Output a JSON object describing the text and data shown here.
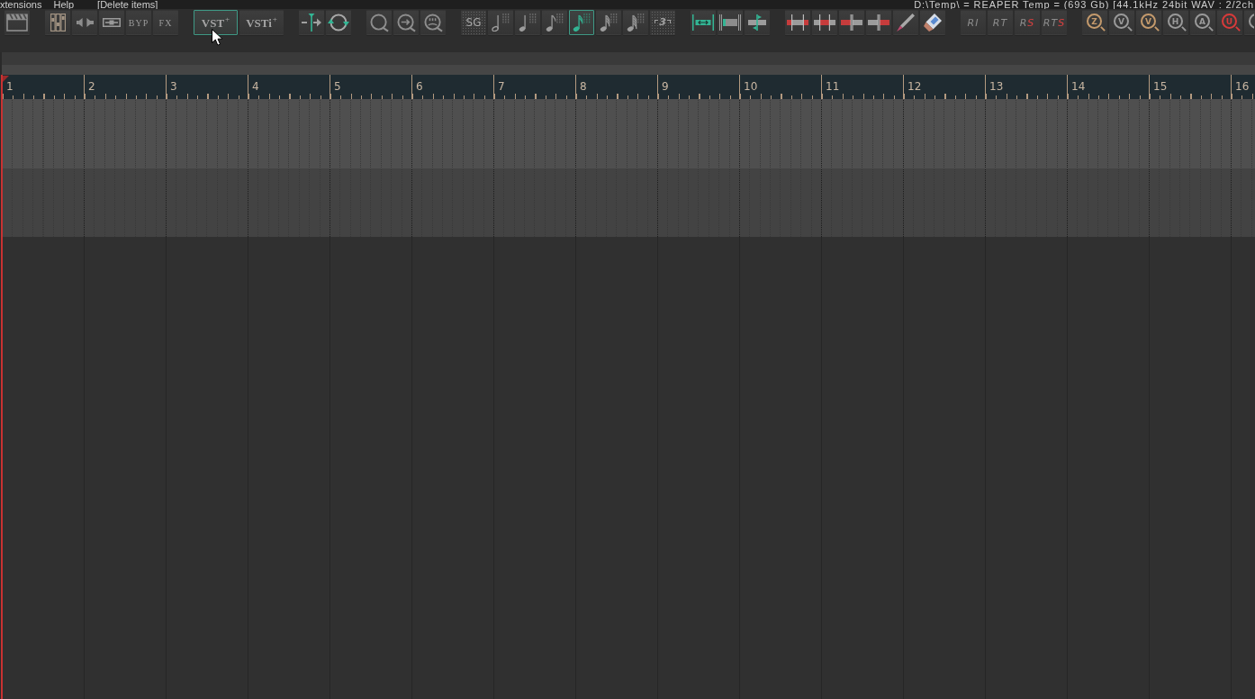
{
  "menu_bar": {
    "items": [
      "xtensions",
      "Help"
    ],
    "last_action": "[Delete items]",
    "project_info": "D:\\Temp\\ = REAPER Temp = (693 Gb) [44.1kHz 24bit WAV : 2/2ch"
  },
  "toolbar": {
    "groups": [
      {
        "buttons": [
          {
            "kind": "clapperboard",
            "selected": false
          }
        ]
      },
      {
        "buttons": [
          {
            "kind": "faders",
            "selected": false
          },
          {
            "kind": "speakers",
            "selected": false
          },
          {
            "kind": "fader-box",
            "selected": false
          },
          {
            "kind": "text",
            "label": "BYP",
            "selected": false
          },
          {
            "kind": "text",
            "label": "FX",
            "selected": false
          }
        ]
      },
      {
        "buttons": [
          {
            "kind": "plugin",
            "label": "VST$^{+}$",
            "selected": true
          },
          {
            "kind": "plugin",
            "label": "VSTi$^{+}$",
            "selected": false
          }
        ]
      },
      {
        "buttons": [
          {
            "kind": "line-arrow",
            "selected": false
          },
          {
            "kind": "loop",
            "selected": false
          }
        ]
      },
      {
        "buttons": [
          {
            "kind": "q-ring",
            "selected": false
          },
          {
            "kind": "q-ring-arrow",
            "selected": false
          },
          {
            "kind": "q-ring-dots",
            "selected": false
          }
        ]
      },
      {
        "buttons": [
          {
            "kind": "dotted-text",
            "label": "SG",
            "selected": false
          },
          {
            "kind": "half-note",
            "selected": false
          },
          {
            "kind": "quarter-note",
            "selected": false
          },
          {
            "kind": "eighth-note",
            "selected": false
          },
          {
            "kind": "sixteenth-note",
            "selected": true
          },
          {
            "kind": "thirty-second-note",
            "selected": false
          },
          {
            "kind": "sixty-fourth-note",
            "selected": false
          },
          {
            "kind": "triplet",
            "label": "3",
            "selected": false
          }
        ]
      },
      {
        "buttons": [
          {
            "kind": "item-move",
            "selected": false
          },
          {
            "kind": "item-edge",
            "selected": false
          },
          {
            "kind": "item-trim",
            "selected": false
          }
        ]
      },
      {
        "buttons": [
          {
            "kind": "split-ends",
            "selected": false
          },
          {
            "kind": "split-middle",
            "selected": false
          },
          {
            "kind": "split-left",
            "selected": false
          },
          {
            "kind": "split-right",
            "selected": false
          },
          {
            "kind": "pencil",
            "selected": false
          },
          {
            "kind": "eraser",
            "selected": false
          }
        ]
      },
      {
        "buttons": [
          {
            "kind": "italic",
            "label": "RI",
            "selected": false
          },
          {
            "kind": "italic",
            "label": "RT",
            "selected": false
          },
          {
            "kind": "italic",
            "label": "R",
            "accent": "S",
            "selected": false
          },
          {
            "kind": "italic",
            "label": "RT",
            "accent": "S",
            "selected": false
          }
        ]
      },
      {
        "buttons": [
          {
            "kind": "lens",
            "label": "Z",
            "color": "#c49a6c",
            "selected": false
          },
          {
            "kind": "lens",
            "label": "V",
            "color": "#9a9a9a",
            "selected": false
          },
          {
            "kind": "lens",
            "label": "V",
            "color": "#c49a6c",
            "selected": false
          },
          {
            "kind": "lens",
            "label": "H",
            "color": "#9a9a9a",
            "selected": false
          },
          {
            "kind": "lens",
            "label": "A",
            "color": "#9a9a9a",
            "selected": false
          },
          {
            "kind": "lens",
            "label": "U",
            "color": "#d83a3a",
            "selected": false
          },
          {
            "kind": "lens",
            "color": "#9a9a9a",
            "selected": false
          }
        ]
      }
    ]
  },
  "ruler": {
    "bars": [
      "1",
      "2",
      "3",
      "4",
      "5",
      "6",
      "7",
      "8",
      "9",
      "10",
      "11",
      "12",
      "13",
      "14",
      "15",
      "16"
    ]
  },
  "tracks": [
    {
      "selected": true
    },
    {
      "selected": false
    }
  ]
}
